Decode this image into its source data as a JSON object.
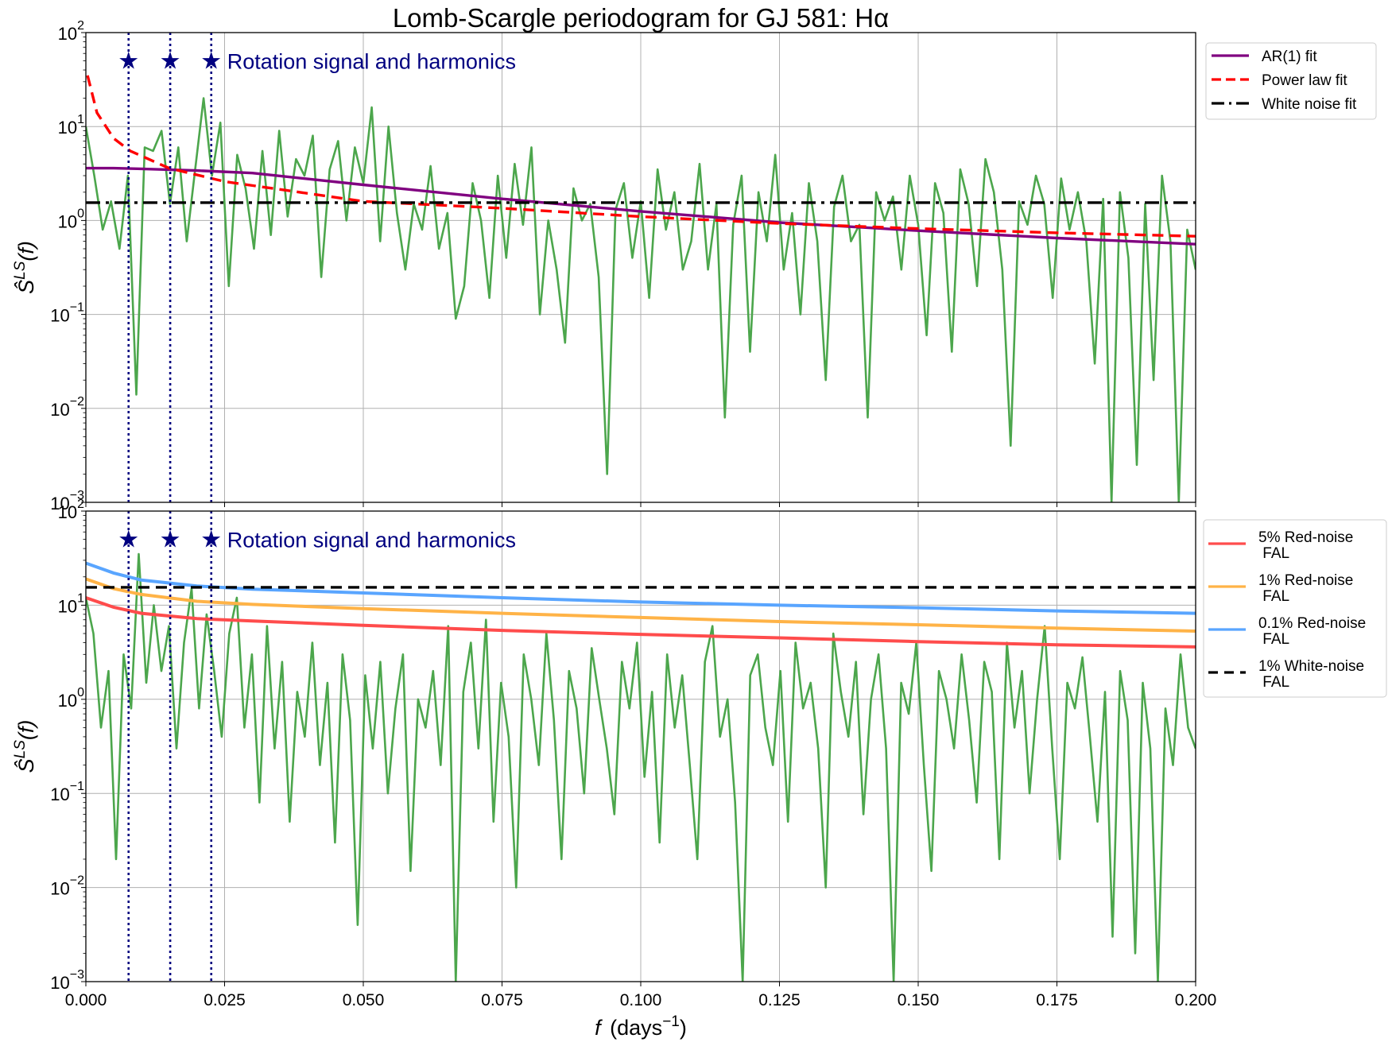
{
  "chart_data": {
    "title": "Lomb-Scargle periodogram for GJ 581: Hα",
    "xlabel_main": "f",
    "xlabel_unit": "(days",
    "xlabel_exp": "−1",
    "xlabel_close": ")",
    "ylabel_main": "Ŝ",
    "ylabel_sup": "LS",
    "ylabel_arg": "(f)",
    "xlim": [
      0,
      0.2
    ],
    "ylim": [
      0.001,
      100
    ],
    "yscale": "log",
    "grid": true,
    "xticks": [
      "0.000",
      "0.025",
      "0.050",
      "0.075",
      "0.100",
      "0.125",
      "0.150",
      "0.175",
      "0.200"
    ],
    "ytick_exponents": [
      "−3",
      "−2",
      "−1",
      "0",
      "1",
      "2"
    ],
    "annotation": {
      "text": "Rotation signal and harmonics",
      "color": "#000080",
      "star_y": 50,
      "rotation_freqs": [
        0.0077,
        0.0152,
        0.0226
      ]
    },
    "panels": [
      {
        "type": "line",
        "legend_position": "outside-top-right",
        "periodogram": {
          "color": "#4ca64c",
          "x_range": [
            0,
            0.2
          ],
          "values": [
            10,
            3,
            0.8,
            1.6,
            0.5,
            3,
            0.014,
            6,
            5.5,
            9,
            1.5,
            6,
            0.6,
            3.5,
            20,
            3,
            11,
            0.2,
            5,
            2.2,
            0.5,
            5.5,
            0.7,
            9,
            1.1,
            4.5,
            3,
            8,
            0.25,
            3.5,
            7,
            1,
            6,
            2.5,
            16,
            0.6,
            10,
            1.2,
            0.3,
            1.5,
            0.8,
            3.8,
            0.5,
            1.2,
            0.09,
            0.2,
            2.5,
            1,
            0.15,
            3,
            0.4,
            4,
            0.9,
            6,
            0.1,
            1,
            0.3,
            0.05,
            2.2,
            1,
            1.5,
            0.25,
            0.002,
            1.3,
            2.5,
            0.4,
            1.6,
            0.15,
            3.5,
            0.8,
            2,
            0.3,
            0.6,
            4,
            0.3,
            1.5,
            0.008,
            0.9,
            3,
            0.04,
            2,
            0.6,
            5,
            0.3,
            1.2,
            0.1,
            2.5,
            0.6,
            0.02,
            1.4,
            3,
            0.6,
            0.9,
            0.008,
            2,
            1,
            1.8,
            0.3,
            3,
            0.9,
            0.06,
            2.5,
            1.2,
            0.04,
            3.5,
            1.5,
            0.2,
            4.5,
            2,
            0.3,
            0.004,
            1.6,
            0.9,
            3,
            1.5,
            0.15,
            2.8,
            0.8,
            2,
            0.6,
            0.03,
            1.7,
            0.001,
            2,
            0.4,
            0.0025,
            1.5,
            0.02,
            3,
            0.6,
            0.001,
            0.8,
            0.3
          ]
        },
        "series": [
          {
            "name": "AR(1) fit",
            "color": "#800080",
            "dash": "",
            "x": [
              0,
              0.005,
              0.01,
              0.02,
              0.03,
              0.05,
              0.075,
              0.1,
              0.125,
              0.15,
              0.175,
              0.2
            ],
            "values": [
              3.6,
              3.6,
              3.55,
              3.4,
              3.2,
              2.4,
              1.7,
              1.25,
              0.95,
              0.78,
              0.65,
              0.56
            ]
          },
          {
            "name": "Power law fit",
            "color": "#ff0000",
            "dash": "14,8",
            "x": [
              0.0003,
              0.002,
              0.005,
              0.008,
              0.015,
              0.025,
              0.05,
              0.075,
              0.1,
              0.125,
              0.15,
              0.175,
              0.2
            ],
            "values": [
              35,
              14,
              7.5,
              5.5,
              3.6,
              2.6,
              1.6,
              1.35,
              1.1,
              0.93,
              0.82,
              0.74,
              0.68
            ]
          },
          {
            "name": "White noise fit",
            "color": "#000000",
            "dash": "18,7,4,7",
            "x": [
              0,
              0.2
            ],
            "values": [
              1.55,
              1.55
            ]
          }
        ]
      },
      {
        "type": "line",
        "legend_position": "outside-top-right",
        "periodogram": {
          "color": "#4ca64c",
          "x_range": [
            0,
            0.2
          ],
          "values": [
            12,
            5,
            0.5,
            2,
            0.02,
            3,
            0.8,
            35,
            1.5,
            10,
            2,
            6,
            0.3,
            4,
            15,
            0.8,
            8,
            2,
            0.4,
            5,
            12,
            0.5,
            3,
            0.08,
            6,
            0.3,
            2.5,
            0.05,
            1.2,
            0.4,
            4,
            0.2,
            1.5,
            0.03,
            3,
            0.6,
            0.004,
            1.8,
            0.3,
            2.5,
            0.1,
            0.8,
            3,
            0.015,
            1,
            0.5,
            2,
            0.2,
            6,
            0.001,
            1.2,
            4,
            0.3,
            7,
            0.05,
            1.5,
            0.4,
            0.01,
            3,
            1,
            0.2,
            5,
            0.6,
            0.02,
            2,
            0.8,
            0.1,
            3.5,
            1,
            0.3,
            0.06,
            2.5,
            0.8,
            4,
            0.15,
            1.2,
            0.03,
            3,
            0.5,
            1.8,
            0.2,
            0.02,
            2.5,
            6,
            0.4,
            1,
            0.08,
            0.001,
            1.8,
            3,
            0.5,
            0.2,
            2,
            0.05,
            4,
            0.8,
            1.5,
            0.3,
            0.01,
            5,
            1.2,
            0.4,
            2.5,
            0.06,
            1,
            3,
            0.3,
            0.001,
            1.5,
            0.7,
            4,
            0.2,
            0.015,
            2,
            1,
            0.3,
            3,
            0.6,
            0.08,
            2.5,
            1.2,
            0.02,
            4,
            0.5,
            2,
            0.1,
            1,
            6,
            0.3,
            0.02,
            1.5,
            0.8,
            2.8,
            0.4,
            0.05,
            1.2,
            0.003,
            2,
            0.6,
            0.002,
            1.5,
            0.3,
            0.001,
            0.8,
            0.2,
            3,
            0.5,
            0.3
          ]
        },
        "series": [
          {
            "name": "5% Red-noise\n FAL",
            "color": "#ff4c4c",
            "dash": "",
            "x": [
              0,
              0.005,
              0.01,
              0.02,
              0.03,
              0.05,
              0.075,
              0.1,
              0.125,
              0.15,
              0.175,
              0.2
            ],
            "values": [
              12,
              9.5,
              8.2,
              7.2,
              6.8,
              6.1,
              5.4,
              4.9,
              4.5,
              4.1,
              3.8,
              3.6
            ]
          },
          {
            "name": "1% Red-noise\n FAL",
            "color": "#ffb347",
            "dash": "",
            "x": [
              0,
              0.005,
              0.01,
              0.02,
              0.03,
              0.05,
              0.075,
              0.1,
              0.125,
              0.15,
              0.175,
              0.2
            ],
            "values": [
              19,
              15,
              13,
              11,
              10.2,
              9.2,
              8.2,
              7.4,
              6.7,
              6.2,
              5.7,
              5.3
            ]
          },
          {
            "name": "0.1% Red-noise\n FAL",
            "color": "#59a5ff",
            "dash": "",
            "x": [
              0,
              0.005,
              0.01,
              0.02,
              0.03,
              0.05,
              0.075,
              0.1,
              0.125,
              0.15,
              0.175,
              0.2
            ],
            "values": [
              28,
              22,
              18.5,
              16,
              14.8,
              13.5,
              12,
              10.8,
              10,
              9.4,
              8.7,
              8.2
            ]
          },
          {
            "name": "1% White-noise\n FAL",
            "color": "#000000",
            "dash": "14,8",
            "x": [
              0,
              0.2
            ],
            "values": [
              15.5,
              15.5
            ]
          }
        ]
      }
    ]
  }
}
